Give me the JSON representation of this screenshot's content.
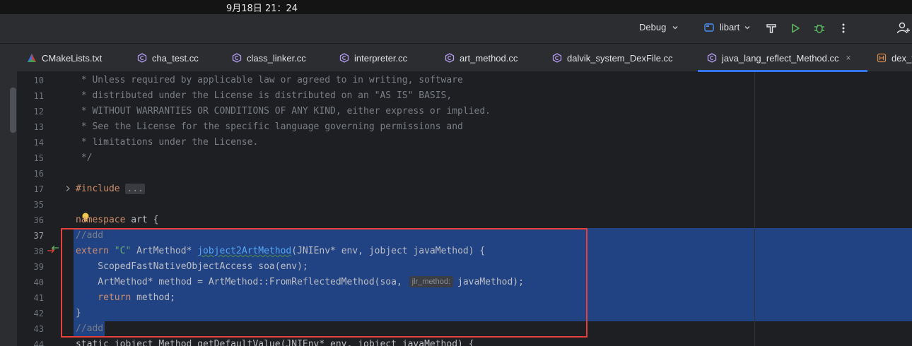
{
  "system_bar": {
    "datetime": "9月18日  21：24"
  },
  "toolbar": {
    "run_config": "Debug",
    "target": "libart",
    "icons": [
      "chevron-down-icon",
      "cmake-target-icon",
      "hammer-icon",
      "run-icon",
      "debug-icon",
      "more-icon",
      "add-user-icon"
    ],
    "colors": {
      "run": "#5fb865",
      "debug": "#5fb865",
      "target_icon": "#4d8ef5"
    }
  },
  "tabs": [
    {
      "label": "CMakeLists.txt",
      "icon": "cmake-icon",
      "active": false
    },
    {
      "label": "cha_test.cc",
      "icon": "cpp-file-icon",
      "active": false
    },
    {
      "label": "class_linker.cc",
      "icon": "cpp-file-icon",
      "active": false
    },
    {
      "label": "interpreter.cc",
      "icon": "cpp-file-icon",
      "active": false
    },
    {
      "label": "art_method.cc",
      "icon": "cpp-file-icon",
      "active": false
    },
    {
      "label": "dalvik_system_DexFile.cc",
      "icon": "cpp-file-icon",
      "active": false
    },
    {
      "label": "java_lang_reflect_Method.cc",
      "icon": "cpp-file-icon",
      "active": true,
      "close": "×"
    },
    {
      "label": "dex_f",
      "icon": "header-file-icon",
      "active": false
    }
  ],
  "editor": {
    "line_numbers": [
      "10",
      "11",
      "12",
      "13",
      "14",
      "15",
      "16",
      "17",
      "35",
      "36",
      "37",
      "38",
      "39",
      "40",
      "41",
      "42",
      "43",
      "44"
    ],
    "current_line": "37",
    "lines": {
      "l10": " * Unless required by applicable law or agreed to in writing, software",
      "l11": " * distributed under the License is distributed on an \"AS IS\" BASIS,",
      "l12": " * WITHOUT WARRANTIES OR CONDITIONS OF ANY KIND, either express or implied.",
      "l13": " * See the License for the specific language governing permissions and",
      "l14": " * limitations under the License.",
      "l15": " */",
      "l17_kw": "#include ",
      "l17_fold": "...",
      "l36_kw": "namespace",
      "l36_rest": " art {",
      "l37": "//add",
      "l38_kw": "extern ",
      "l38_str": "\"C\"",
      "l38_a": " ArtMethod* ",
      "l38_fn": "jobject2ArtMethod",
      "l38_b": "(JNIEnv* env, jobject javaMethod) {",
      "l39": "    ScopedFastNativeObjectAccess soa(env);",
      "l40_a": "    ArtMethod* method = ArtMethod::FromReflectedMethod(soa, ",
      "l40_hint": "jlr_method:",
      "l40_b": "javaMethod);",
      "l41_kw": "    return",
      "l41_rest": " method;",
      "l42": "}",
      "l43": "//add",
      "l44": "static jobject Method_getDefaultValue(JNIEnv* env, jobject javaMethod) {"
    },
    "colors": {
      "selection": "#214283",
      "highlight_box": "#e5403a",
      "comment": "#7a7e85",
      "keyword": "#cf8e6d",
      "string": "#6aab73",
      "function": "#56a8f5"
    }
  }
}
